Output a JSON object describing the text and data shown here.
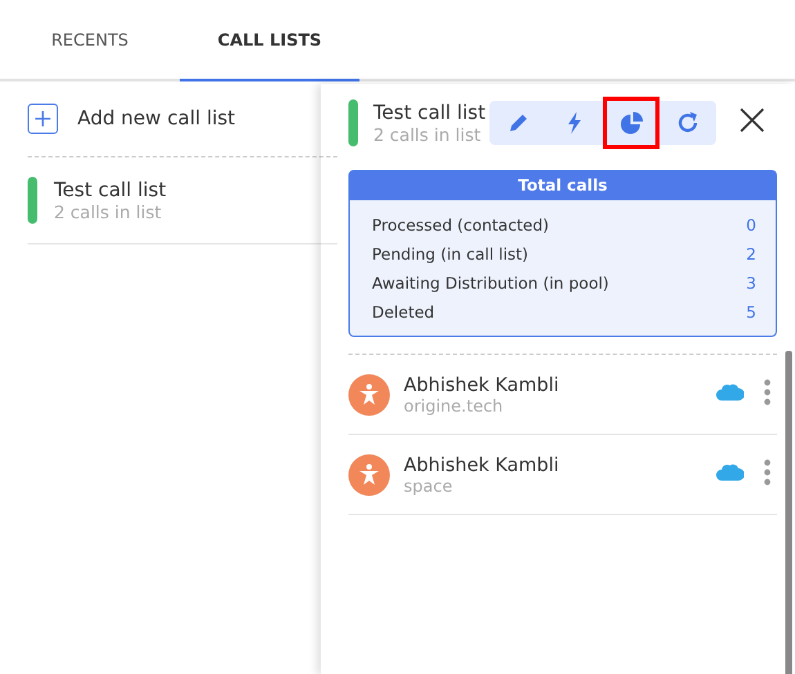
{
  "tabs": [
    {
      "label": "RECENTS",
      "selected": false
    },
    {
      "label": "CALL LISTS",
      "selected": true
    }
  ],
  "add_button": {
    "label": "Add new call list"
  },
  "call_lists": [
    {
      "name": "Test call list",
      "subtitle": "2 calls in list",
      "color": "#46bd6e"
    }
  ],
  "detail": {
    "title": "Test call list",
    "subtitle": "2 calls in list",
    "color": "#46bd6e",
    "toolbar": [
      {
        "kind": "edit",
        "selected": false
      },
      {
        "kind": "bolt",
        "selected": false
      },
      {
        "kind": "chart",
        "selected": true
      },
      {
        "kind": "refresh",
        "selected": false
      }
    ],
    "stats": {
      "title": "Total calls",
      "rows": [
        {
          "label": "Processed (contacted)",
          "value": "0"
        },
        {
          "label": "Pending (in call list)",
          "value": "2"
        },
        {
          "label": "Awaiting Distribution (in pool)",
          "value": "3"
        },
        {
          "label": "Deleted",
          "value": "5"
        }
      ]
    },
    "contacts": [
      {
        "name": "Abhishek Kambli",
        "company": "origine.tech"
      },
      {
        "name": "Abhishek Kambli",
        "company": "space"
      }
    ]
  }
}
